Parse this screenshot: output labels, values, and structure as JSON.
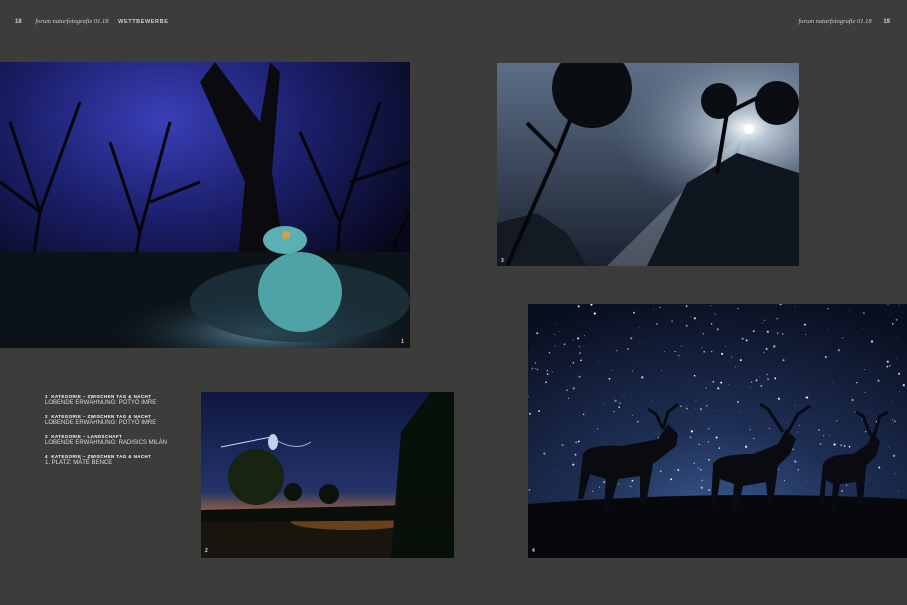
{
  "header": {
    "left": {
      "page": "18",
      "magazine": "forum naturfotografie 01.18",
      "section": "WETTBEWERBE"
    },
    "right": {
      "magazine": "forum naturfotografie 01.18",
      "page": "19"
    }
  },
  "photos": [
    {
      "number": "1",
      "subject": "toad"
    },
    {
      "number": "2",
      "subject": "mayfly"
    },
    {
      "number": "3",
      "subject": "forest-sunrays"
    },
    {
      "number": "4",
      "subject": "deer-starry-sky"
    }
  ],
  "captions": [
    {
      "number": "1",
      "title": "KATEGORIE – ZWISCHEN TAG & NACHT",
      "subtitle": "LOBENDE ERWÄHNUNG: POTYÓ IMRE"
    },
    {
      "number": "2",
      "title": "KATEGORIE – ZWISCHEN TAG & NACHT",
      "subtitle": "LOBENDE ERWÄHNUNG: POTYÓ IMRE"
    },
    {
      "number": "3",
      "title": "KATEGORIE – LANDSCHAFT",
      "subtitle": "LOBENDE ERWÄHNUNG: RADISICS MILÁN"
    },
    {
      "number": "4",
      "title": "KATEGORIE – ZWISCHEN TAG & NACHT",
      "subtitle": "1. PLATZ: MÁTÉ BENCE"
    }
  ],
  "colors": {
    "background": "#3c3c3b",
    "night_blue": "#1d2a6b",
    "horizon_orange": "#c7762c"
  }
}
